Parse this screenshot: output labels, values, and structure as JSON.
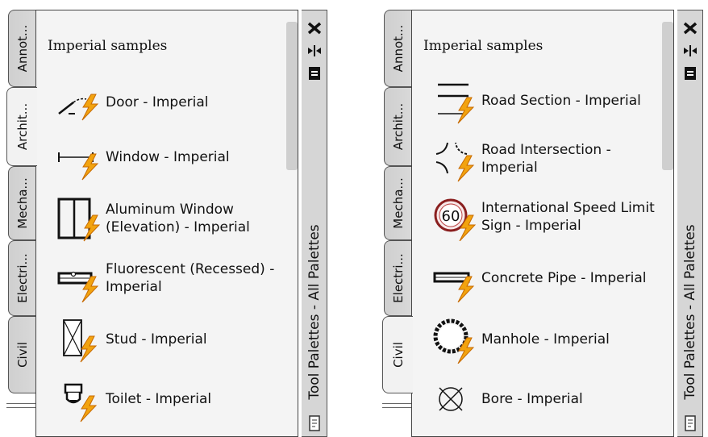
{
  "palettes": [
    {
      "tabs": [
        {
          "label": "Annot...",
          "active": false
        },
        {
          "label": "Archit...",
          "active": true
        },
        {
          "label": "Mecha...",
          "active": false
        },
        {
          "label": "Electri...",
          "active": false
        },
        {
          "label": "Civil",
          "active": false
        }
      ],
      "title": "Imperial samples",
      "items": [
        {
          "label": "Door - Imperial",
          "icon": "door-icon"
        },
        {
          "label": "Window - Imperial",
          "icon": "window-icon"
        },
        {
          "label": "Aluminum Window (Elevation) - Imperial",
          "icon": "aluminum-window-icon"
        },
        {
          "label": "Fluorescent (Recessed) - Imperial",
          "icon": "fluorescent-light-icon"
        },
        {
          "label": "Stud - Imperial",
          "icon": "stud-icon"
        },
        {
          "label": "Toilet - Imperial",
          "icon": "toilet-icon"
        }
      ],
      "strip": {
        "close_icon": "close-icon",
        "autohide_icon": "auto-hide-icon",
        "properties_icon": "properties-icon",
        "title": "Tool Palettes - All Palettes"
      }
    },
    {
      "tabs": [
        {
          "label": "Annot...",
          "active": false
        },
        {
          "label": "Archit...",
          "active": false
        },
        {
          "label": "Mecha...",
          "active": false
        },
        {
          "label": "Electri...",
          "active": false
        },
        {
          "label": "Civil",
          "active": true
        }
      ],
      "title": "Imperial samples",
      "items": [
        {
          "label": "Road Section - Imperial",
          "icon": "road-section-icon"
        },
        {
          "label": "Road Intersection - Imperial",
          "icon": "road-intersection-icon"
        },
        {
          "label": "International Speed Limit Sign - Imperial",
          "icon": "speed-limit-sign-icon",
          "sign_text": "60"
        },
        {
          "label": "Concrete Pipe - Imperial",
          "icon": "concrete-pipe-icon"
        },
        {
          "label": "Manhole - Imperial",
          "icon": "manhole-icon"
        },
        {
          "label": "Bore - Imperial",
          "icon": "bore-icon"
        }
      ],
      "strip": {
        "close_icon": "close-icon",
        "autohide_icon": "auto-hide-icon",
        "properties_icon": "properties-icon",
        "title": "Tool Palettes - All Palettes"
      }
    }
  ],
  "colors": {
    "panel_bg": "#f4f4f4",
    "tab_bg": "#d4d4d4",
    "strip_bg": "#d6d6d6",
    "bolt": "#f2a30f",
    "bolt_stroke": "#c76a00"
  }
}
